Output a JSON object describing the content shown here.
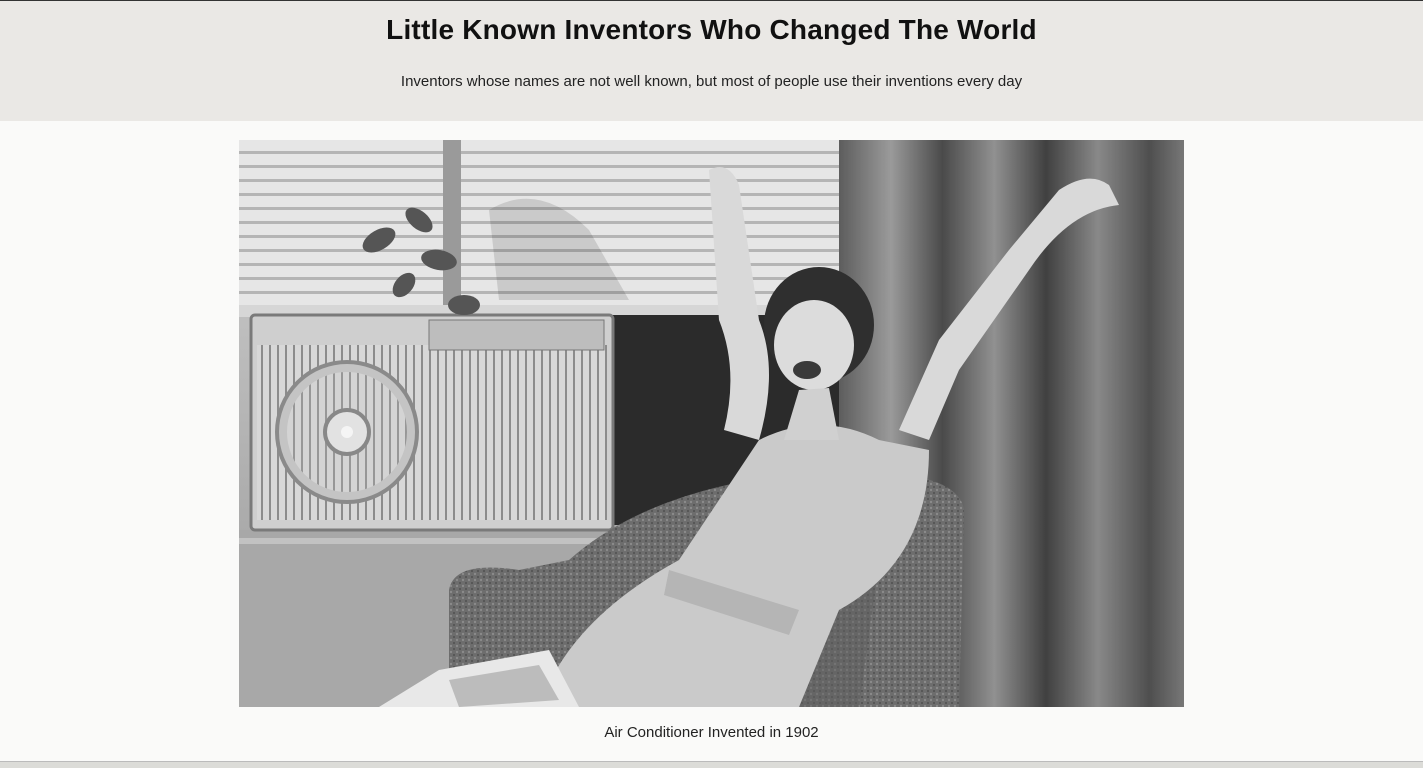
{
  "header": {
    "title": "Little Known Inventors Who Changed The World",
    "subtitle": "Inventors whose names are not well known, but most of people use their inventions every day"
  },
  "figure": {
    "image_alt": "Woman stretching in an armchair next to a window air conditioner",
    "caption": "Air Conditioner Invented in 1902"
  }
}
